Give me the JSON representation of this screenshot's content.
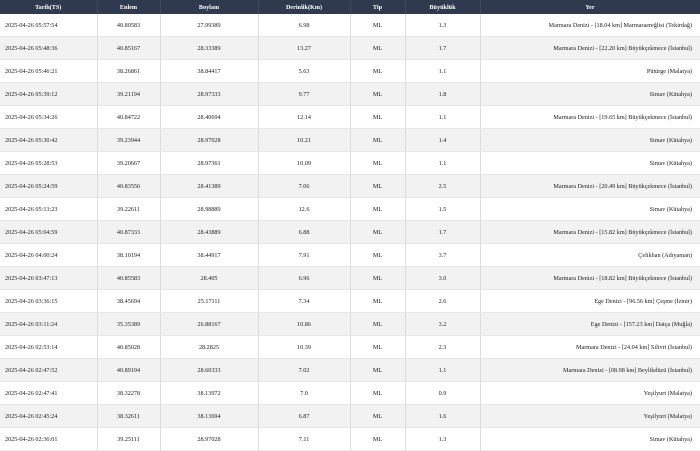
{
  "headers": [
    "Tarih(TS)",
    "Enlem",
    "Boylam",
    "Derinlik(Km)",
    "Tip",
    "Büyüklük",
    "Yer"
  ],
  "rows": [
    [
      "2025-04-26 05:57:54",
      "40.80583",
      "27.99389",
      "6.98",
      "ML",
      "1.3",
      "Marmara Denizi - [18.04 km] Marmaraereğlisi (Tekirdağ)"
    ],
    [
      "2025-04-26 05:48:36",
      "40.85167",
      "28.33389",
      "13.27",
      "ML",
      "1.7",
      "Marmara Denizi - [22.20 km] Büyükçekmece (İstanbul)"
    ],
    [
      "2025-04-26 05:46:21",
      "38.26861",
      "38.84417",
      "5.63",
      "ML",
      "1.1",
      "Pütürge (Malatya)"
    ],
    [
      "2025-04-26 05:39:12",
      "39.21194",
      "28.97333",
      "9.77",
      "ML",
      "1.8",
      "Simav (Kütahya)"
    ],
    [
      "2025-04-26 05:34:26",
      "40.84722",
      "28.40694",
      "12.14",
      "ML",
      "1.1",
      "Marmara Denizi - [19.65 km] Büyükçekmece (İstanbul)"
    ],
    [
      "2025-04-26 05:30:42",
      "39.23944",
      "28.97028",
      "10.21",
      "ML",
      "1.4",
      "Simav (Kütahya)"
    ],
    [
      "2025-04-26 05:28:53",
      "39.20667",
      "28.97361",
      "10.09",
      "ML",
      "1.1",
      "Simav (Kütahya)"
    ],
    [
      "2025-04-26 05:24:59",
      "40.83556",
      "28.41389",
      "7.06",
      "ML",
      "2.5",
      "Marmara Denizi - [20.49 km] Büyükçekmece (İstanbul)"
    ],
    [
      "2025-04-26 05:13:23",
      "39.22611",
      "28.98889",
      "12.6",
      "ML",
      "1.5",
      "Simav (Kütahya)"
    ],
    [
      "2025-04-26 05:04:59",
      "40.87333",
      "28.43889",
      "6.88",
      "ML",
      "1.7",
      "Marmara Denizi - [15.82 km] Büyükçekmece (İstanbul)"
    ],
    [
      "2025-04-26 04:00:24",
      "38.10194",
      "38.44917",
      "7.91",
      "ML",
      "3.7",
      "Çelikhan (Adıyaman)"
    ],
    [
      "2025-04-26 03:47:13",
      "40.85583",
      "28.405",
      "6.96",
      "ML",
      "3.0",
      "Marmara Denizi - [18.82 km] Büyükçekmece (İstanbul)"
    ],
    [
      "2025-04-26 03:36:15",
      "38.45694",
      "25.17111",
      "7.34",
      "ML",
      "2.6",
      "Ege Denizi - [96.56 km] Çeşme (İzmir)"
    ],
    [
      "2025-04-26 03:11:24",
      "35.35389",
      "26.88167",
      "10.86",
      "ML",
      "3.2",
      "Ege Denizi - [157.23 km] Datça (Muğla)"
    ],
    [
      "2025-04-26 02:53:14",
      "40.85028",
      "28.2825",
      "10.39",
      "ML",
      "2.3",
      "Marmara Denizi - [24.04 km] Silivri (İstanbul)"
    ],
    [
      "2025-04-26 02:47:52",
      "40.89194",
      "28.60333",
      "7.02",
      "ML",
      "1.1",
      "Marmara Denizi - [08.98 km] Beylikdüzü (İstanbul)"
    ],
    [
      "2025-04-26 02:47:41",
      "38.32278",
      "38.13972",
      "7.0",
      "ML",
      "0.9",
      "Yeşilyurt (Malatya)"
    ],
    [
      "2025-04-26 02:45:24",
      "38.32611",
      "38.13694",
      "6.87",
      "ML",
      "1.6",
      "Yeşilyurt (Malatya)"
    ],
    [
      "2025-04-26 02:36:01",
      "39.25111",
      "28.97028",
      "7.11",
      "ML",
      "1.3",
      "Simav (Kütahya)"
    ]
  ]
}
